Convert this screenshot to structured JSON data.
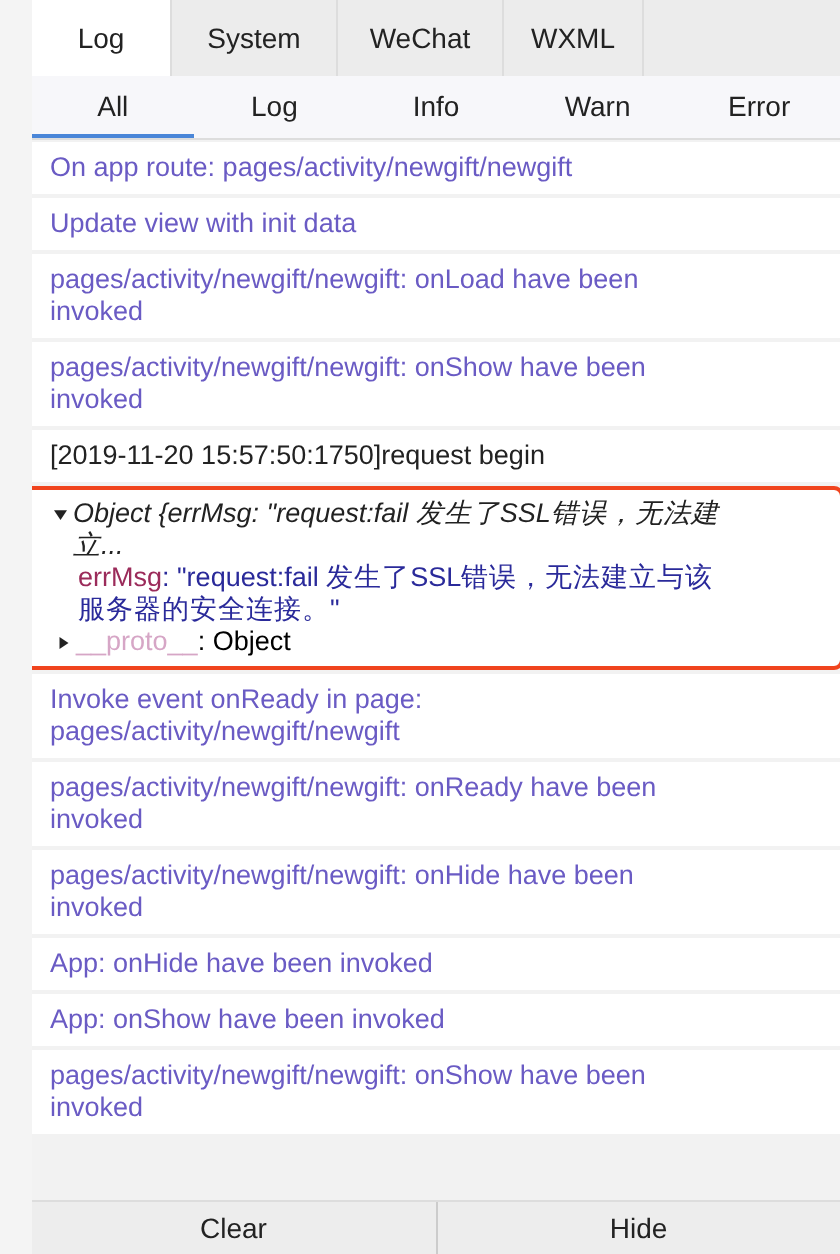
{
  "tabs": [
    {
      "label": "Log",
      "selected": true
    },
    {
      "label": "System",
      "selected": false
    },
    {
      "label": "WeChat",
      "selected": false
    },
    {
      "label": "WXML",
      "selected": false
    }
  ],
  "filters": [
    {
      "label": "All",
      "selected": true
    },
    {
      "label": "Log",
      "selected": false
    },
    {
      "label": "Info",
      "selected": false
    },
    {
      "label": "Warn",
      "selected": false
    },
    {
      "label": "Error",
      "selected": false
    }
  ],
  "entries": [
    {
      "kind": "info",
      "text": "On app route: pages/activity/newgift/newgift"
    },
    {
      "kind": "info",
      "text": "Update view with init data"
    },
    {
      "kind": "info",
      "text": "pages/activity/newgift/newgift: onLoad have been invoked"
    },
    {
      "kind": "info",
      "text": "pages/activity/newgift/newgift: onShow have been invoked"
    },
    {
      "kind": "log",
      "text": "[2019-11-20 15:57:50:1750]request begin"
    },
    {
      "kind": "object",
      "highlighted": true,
      "expanded": true,
      "summary": "Object {errMsg: \"request:fail 发生了SSL错误，无法建立...",
      "key": "errMsg",
      "value": ": \"request:fail 发生了SSL错误，无法建立与该服务器的安全连接。\"",
      "proto_key": "__proto__",
      "proto_value": ": Object"
    },
    {
      "kind": "info",
      "text": "Invoke event onReady in page: pages/activity/newgift/newgift"
    },
    {
      "kind": "info",
      "text": "pages/activity/newgift/newgift: onReady have been invoked"
    },
    {
      "kind": "info",
      "text": "pages/activity/newgift/newgift: onHide have been invoked"
    },
    {
      "kind": "info",
      "text": "App: onHide have been invoked"
    },
    {
      "kind": "info",
      "text": "App: onShow have been invoked"
    },
    {
      "kind": "info",
      "text": "pages/activity/newgift/newgift: onShow have been invoked"
    }
  ],
  "buttons": [
    "Clear",
    "Hide"
  ]
}
